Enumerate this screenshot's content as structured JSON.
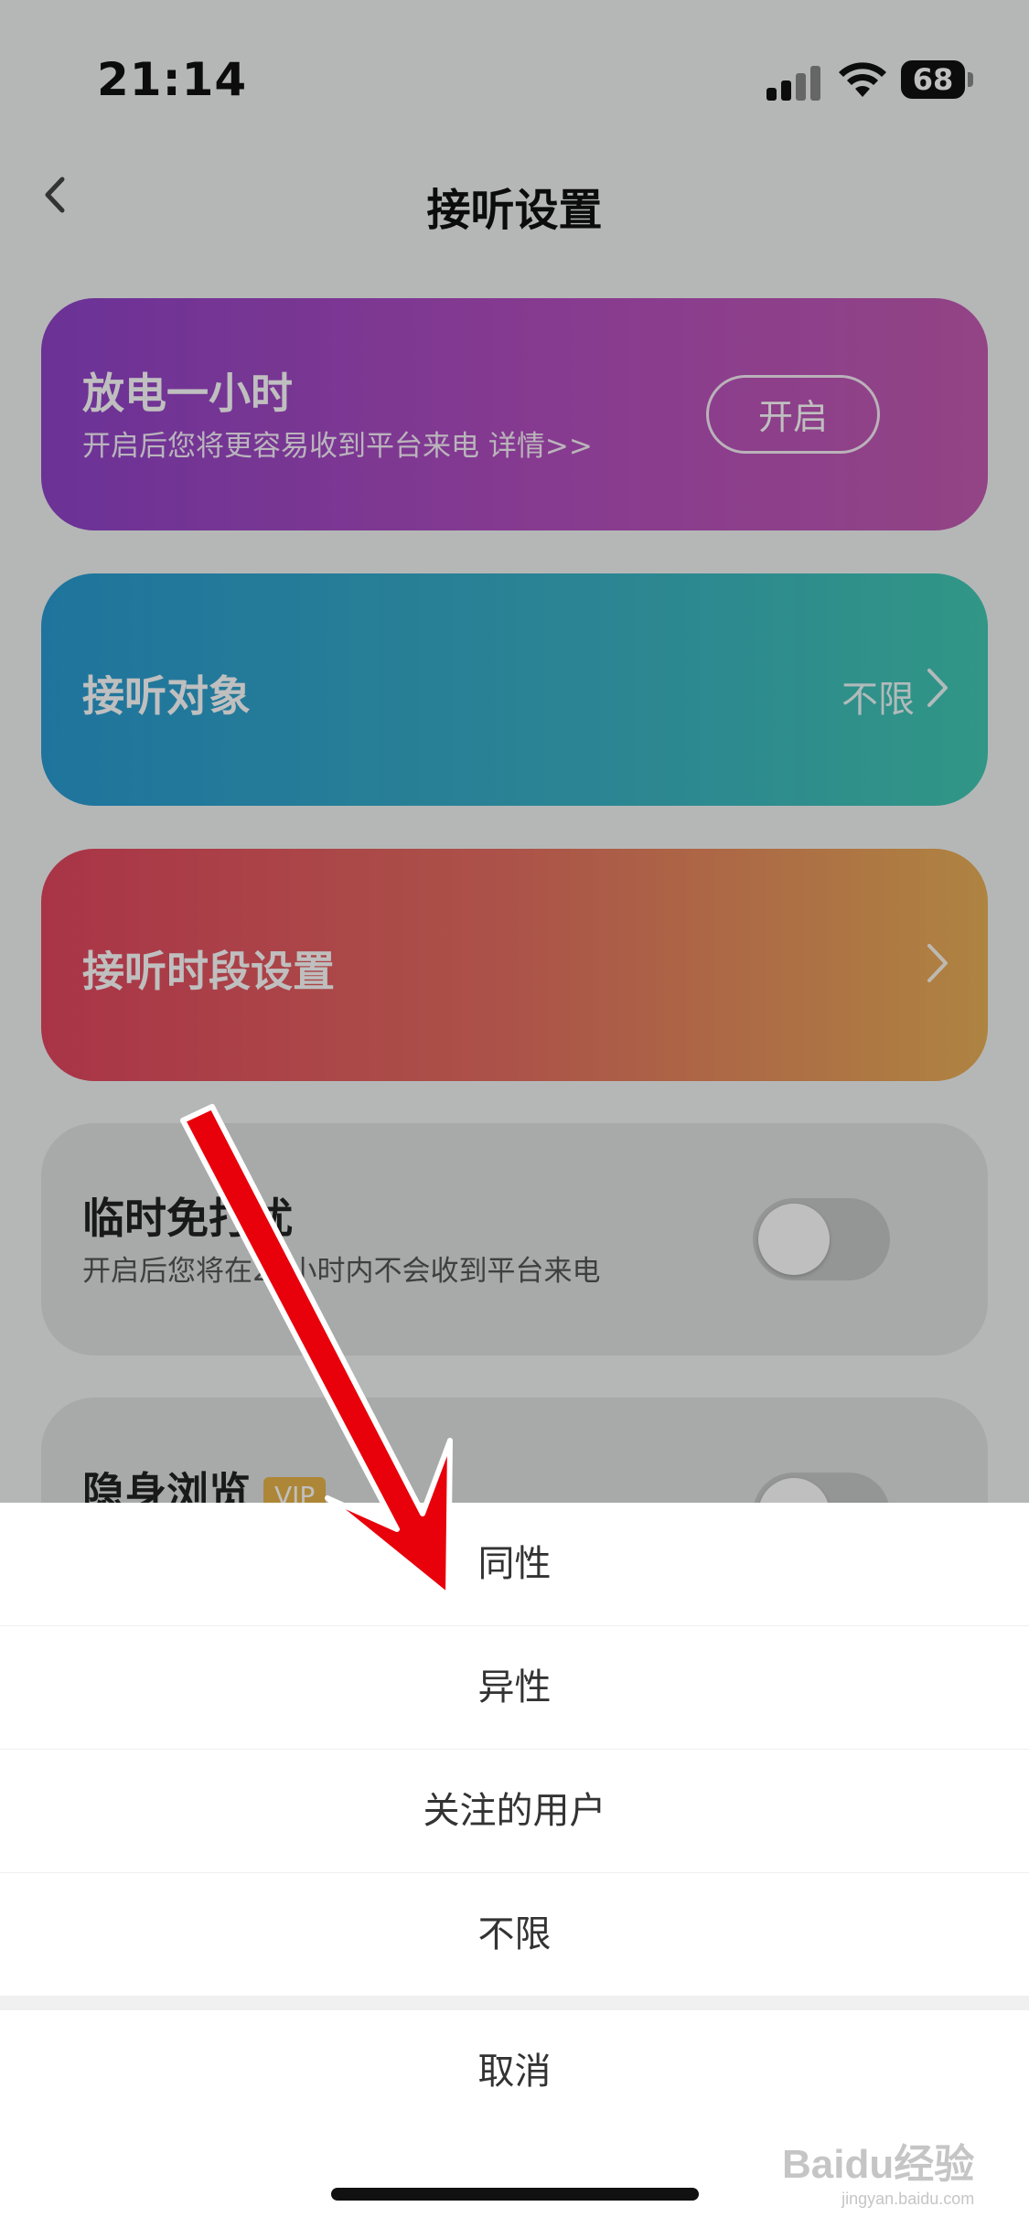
{
  "status_bar": {
    "time": "21:14",
    "battery": "68"
  },
  "nav": {
    "title": "接听设置"
  },
  "cards": {
    "discharge": {
      "title": "放电一小时",
      "subtitle": "开启后您将更容易收到平台来电  详情>>",
      "button": "开启"
    },
    "audience": {
      "title": "接听对象",
      "value": "不限"
    },
    "schedule": {
      "title": "接听时段设置"
    },
    "dnd": {
      "title": "临时免打扰",
      "subtitle": "开启后您将在24小时内不会收到平台来电",
      "enabled": false
    },
    "incognito": {
      "title": "隐身浏览",
      "badge": "VIP",
      "enabled": false
    }
  },
  "action_sheet": {
    "options": [
      "同性",
      "异性",
      "关注的用户",
      "不限"
    ],
    "cancel": "取消"
  },
  "watermark": {
    "brand": "Baidu经验",
    "url": "jingyan.baidu.com"
  },
  "colors": {
    "annotation_arrow": "#e8000b"
  }
}
